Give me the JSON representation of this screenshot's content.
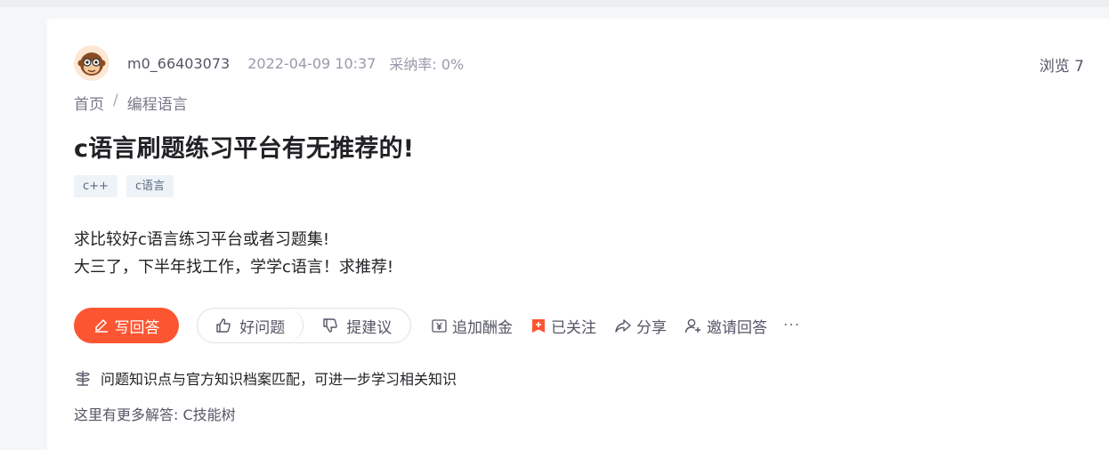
{
  "meta": {
    "username": "m0_66403073",
    "datetime": "2022-04-09 10:37",
    "accept_rate": "采纳率: 0%",
    "views": "浏览 7"
  },
  "breadcrumb": {
    "home": "首页",
    "separator": "/",
    "category": "编程语言"
  },
  "question": {
    "title": "c语言刷题练习平台有无推荐的!",
    "tags": [
      "c++",
      "c语言"
    ],
    "body_lines": [
      "求比较好c语言练习平台或者习题集!",
      "大三了，下半年找工作，学学c语言！求推荐!"
    ]
  },
  "actions": {
    "answer": "写回答",
    "good_question": "好问题",
    "suggest": "提建议",
    "add_bounty": "追加酬金",
    "followed": "已关注",
    "share": "分享",
    "invite": "邀请回答",
    "more": "···"
  },
  "knowledge": {
    "match_text": "问题知识点与官方知识档案匹配，可进一步学习相关知识",
    "more_answers": "这里有更多解答: C技能树"
  },
  "colors": {
    "accent": "#fc5531",
    "followed_icon": "#fc5531",
    "tag_bg": "#eef3f8"
  }
}
